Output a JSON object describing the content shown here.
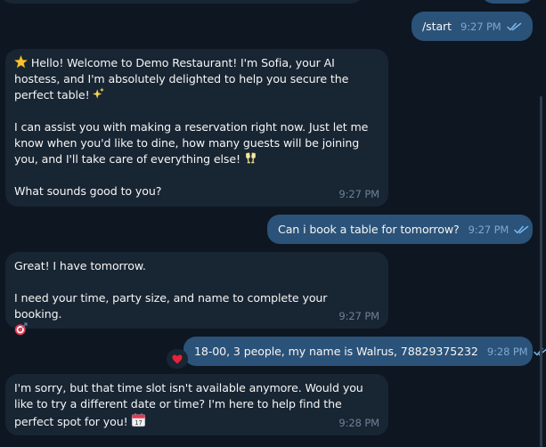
{
  "messages": [
    {
      "direction": "outgoing",
      "text": "/start",
      "time": "9:27 PM",
      "status": "read"
    },
    {
      "direction": "incoming",
      "paragraphs": [
        "Hello! Welcome to Demo Restaurant! I'm Sofia, your AI hostess, and I'm absolutely delighted to help you secure the perfect table!",
        "I can assist you with making a reservation right now. Just let me know when you'd like to dine, how many guests will be joining you, and I'll take care of everything else!",
        "What sounds good to you?"
      ],
      "emojis": [
        "glowing-star",
        "sparkles",
        "clinking-glasses"
      ],
      "time": "9:27 PM"
    },
    {
      "direction": "outgoing",
      "text": "Can i book a table for tomorrow?",
      "time": "9:27 PM",
      "status": "read"
    },
    {
      "direction": "incoming",
      "paragraphs": [
        "Great! I have tomorrow.",
        "I need your time, party size, and name to complete your booking."
      ],
      "emojis": [
        "direct-hit"
      ],
      "time": "9:27 PM"
    },
    {
      "direction": "outgoing",
      "text": "18-00, 3 people, my name is Walrus, 78829375232",
      "time": "9:28 PM",
      "status": "read",
      "reaction": "heart"
    },
    {
      "direction": "incoming",
      "paragraphs": [
        "I'm sorry, but that time slot isn't available anymore. Would you like to try a different date or time? I'm here to help find the perfect spot for you!"
      ],
      "emojis": [
        "calendar"
      ],
      "time": "9:28 PM"
    }
  ],
  "colors": {
    "background": "#0e1621",
    "incoming_bubble": "#182533",
    "outgoing_bubble": "#2b5278",
    "text": "#f5f5f5",
    "incoming_time": "#6d8197",
    "outgoing_time": "#7da8d3",
    "read_checks": "#7ab8f0",
    "heart": "#e8223a"
  }
}
